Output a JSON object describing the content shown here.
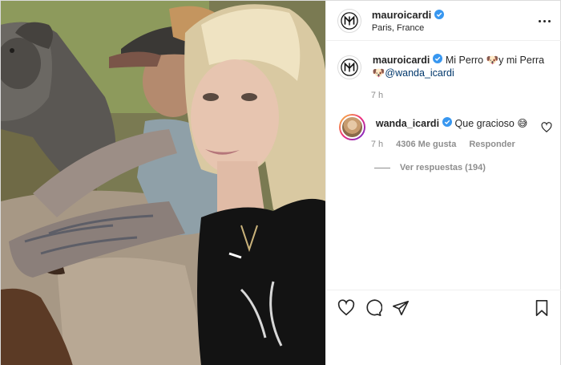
{
  "header": {
    "username": "mauroicardi",
    "location": "Paris, France"
  },
  "caption": {
    "username": "mauroicardi",
    "text_part1": " Mi Perro ",
    "text_part2": "y mi Perra ",
    "mention": "@wanda_icardi",
    "time": "7 h"
  },
  "comment": {
    "username": "wanda_icardi",
    "text": " Que gracioso ",
    "time": "7 h",
    "likes": "4306 Me gusta",
    "reply_label": "Responder",
    "view_replies": "Ver respuestas (194)"
  },
  "icons": {
    "avatar": "mi-monogram-logo",
    "verified": "verified-badge-icon",
    "more": "more-options-icon",
    "dog_emoji": "dog-face-emoji",
    "smile_emoji": "grinning-sweat-emoji",
    "like": "heart-icon",
    "comment": "comment-bubble-icon",
    "share": "paper-plane-icon",
    "save": "bookmark-icon"
  },
  "colors": {
    "verified_blue": "#3897f0",
    "mention": "#00376b",
    "muted": "#8e8e8e"
  }
}
